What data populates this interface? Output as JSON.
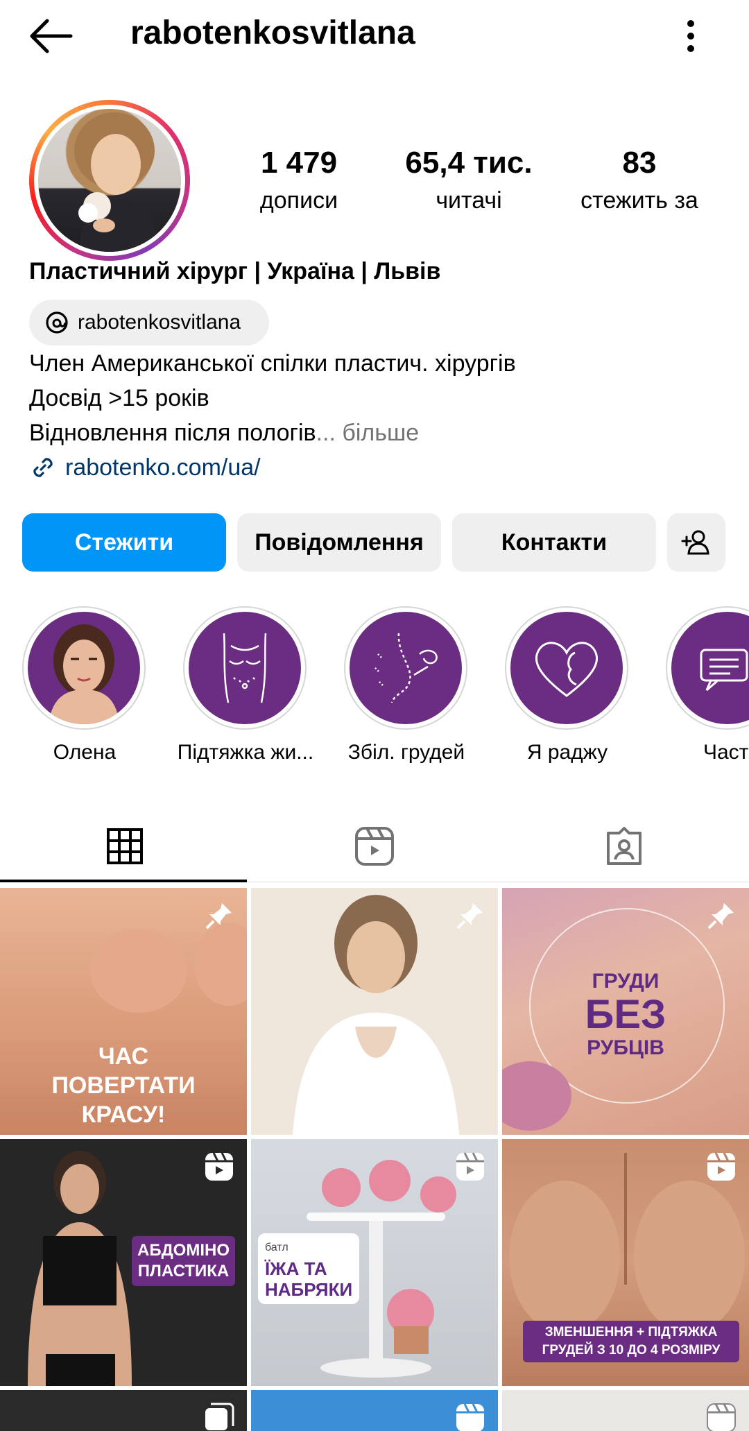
{
  "header": {
    "username": "rabotenkosvitlana"
  },
  "stats": [
    {
      "value": "1 479",
      "label": "дописи"
    },
    {
      "value": "65,4 тис.",
      "label": "читачі"
    },
    {
      "value": "83",
      "label": "стежить за"
    }
  ],
  "bio": {
    "name": "Пластичний хірург | Україна | Львів",
    "threads_handle": "rabotenkosvitlana",
    "lines": [
      "Член Американської спілки пластич. хірургів",
      "Досвід >15 років",
      "Відновлення після пологів"
    ],
    "more_label": "... більше",
    "link": "rabotenko.com/ua/"
  },
  "actions": {
    "follow_label": "Стежити",
    "message_label": "Повідомлення",
    "contacts_label": "Контакти"
  },
  "highlights": [
    {
      "label": "Олена",
      "icon": "portrait-photo"
    },
    {
      "label": "Підтяжка жи...",
      "icon": "torso-outline-icon"
    },
    {
      "label": "Збіл. грудей",
      "icon": "breast-profile-icon"
    },
    {
      "label": "Я раджу",
      "icon": "heart-face-icon"
    },
    {
      "label": "Часті ",
      "icon": "chat-bubbles-icon"
    }
  ],
  "tabs": [
    "grid-icon",
    "reels-icon",
    "tagged-icon"
  ],
  "grid": {
    "posts": [
      {
        "type": "pinned",
        "text_lines": [
          "ЧАС",
          "ПОВЕРТАТИ",
          "КРАСУ!"
        ]
      },
      {
        "type": "pinned",
        "text_lines": []
      },
      {
        "type": "pinned",
        "text_lines": [
          "ГРУДИ",
          "БЕЗ",
          "РУБЦІВ"
        ]
      },
      {
        "type": "reel",
        "text_lines": [
          "АБДОМІНО",
          "ПЛАСТИКА"
        ]
      },
      {
        "type": "reel",
        "small": "батл",
        "text_lines": [
          "ЇЖА ТА",
          "НАБРЯКИ"
        ]
      },
      {
        "type": "reel",
        "text_lines": [
          "ЗМЕНШЕННЯ + ПІДТЯЖКА",
          "ГРУДЕЙ З 10 ДО 4 РОЗМІРУ"
        ]
      }
    ]
  },
  "colors": {
    "accent": "#0095f6",
    "highlight_bg": "#6b2d82",
    "link": "#00376b",
    "muted": "#737373"
  }
}
